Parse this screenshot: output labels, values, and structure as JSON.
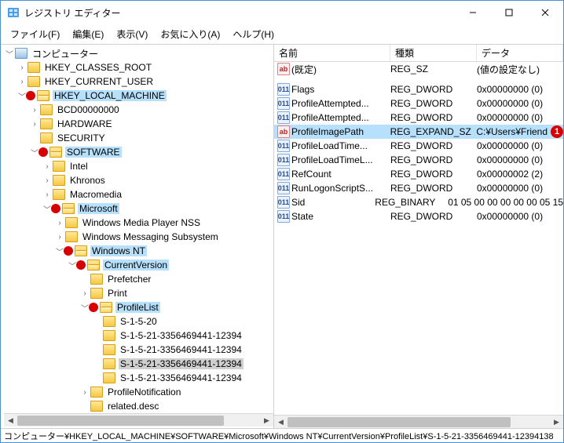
{
  "window": {
    "title": "レジストリ エディター"
  },
  "menu": {
    "file": "ファイル(F)",
    "edit": "編集(E)",
    "view": "表示(V)",
    "fav": "お気に入り(A)",
    "help": "ヘルプ(H)"
  },
  "tree": {
    "root": "コンピューター",
    "hkcr": "HKEY_CLASSES_ROOT",
    "hkcu": "HKEY_CURRENT_USER",
    "hklm": "HKEY_LOCAL_MACHINE",
    "bcd": "BCD00000000",
    "hardware": "HARDWARE",
    "security": "SECURITY",
    "software": "SOFTWARE",
    "intel": "Intel",
    "khronos": "Khronos",
    "macromedia": "Macromedia",
    "microsoft": "Microsoft",
    "wmp": "Windows Media Player NSS",
    "wms": "Windows Messaging Subsystem",
    "winnt": "Windows NT",
    "curver": "CurrentVersion",
    "prefetcher": "Prefetcher",
    "print": "Print",
    "profilelist": "ProfileList",
    "s20": "S-1-5-20",
    "s21a": "S-1-5-21-3356469441-12394",
    "s21b": "S-1-5-21-3356469441-12394",
    "s21c": "S-1-5-21-3356469441-12394",
    "s21d": "S-1-5-21-3356469441-12394",
    "profnotif": "ProfileNotification",
    "related": "related.desc"
  },
  "list": {
    "hdr_name": "名前",
    "hdr_type": "種類",
    "hdr_data": "データ",
    "rows": [
      {
        "icon": "string",
        "name": "(既定)",
        "type": "REG_SZ",
        "data": "(値の設定なし)"
      },
      {
        "spacer": true
      },
      {
        "icon": "binary",
        "name": "Flags",
        "type": "REG_DWORD",
        "data": "0x00000000 (0)"
      },
      {
        "icon": "binary",
        "name": "ProfileAttempted...",
        "type": "REG_DWORD",
        "data": "0x00000000 (0)"
      },
      {
        "icon": "binary",
        "name": "ProfileAttempted...",
        "type": "REG_DWORD",
        "data": "0x00000000 (0)"
      },
      {
        "icon": "string",
        "name": "ProfileImagePath",
        "type": "REG_EXPAND_SZ",
        "data": "C:¥Users¥Friend",
        "selected": true,
        "badge": "1"
      },
      {
        "icon": "binary",
        "name": "ProfileLoadTime...",
        "type": "REG_DWORD",
        "data": "0x00000000 (0)"
      },
      {
        "icon": "binary",
        "name": "ProfileLoadTimeL...",
        "type": "REG_DWORD",
        "data": "0x00000000 (0)"
      },
      {
        "icon": "binary",
        "name": "RefCount",
        "type": "REG_DWORD",
        "data": "0x00000002 (2)"
      },
      {
        "icon": "binary",
        "name": "RunLogonScriptS...",
        "type": "REG_DWORD",
        "data": "0x00000000 (0)"
      },
      {
        "icon": "binary",
        "name": "Sid",
        "type": "REG_BINARY",
        "data": "01 05 00 00 00 00 00 05 15"
      },
      {
        "icon": "binary",
        "name": "State",
        "type": "REG_DWORD",
        "data": "0x00000000 (0)"
      }
    ]
  },
  "status": "コンピューター¥HKEY_LOCAL_MACHINE¥SOFTWARE¥Microsoft¥Windows NT¥CurrentVersion¥ProfileList¥S-1-5-21-3356469441-12394138"
}
